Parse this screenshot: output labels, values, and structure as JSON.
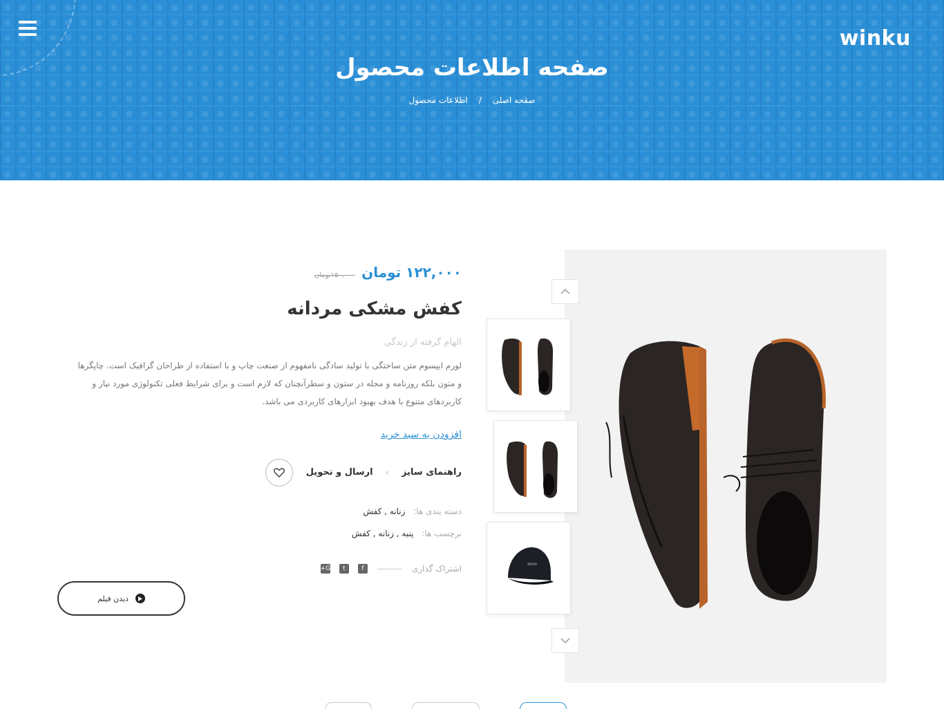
{
  "header": {
    "logo": "winku",
    "title": "صفحه اطلاعات محصول",
    "breadcrumb": {
      "home": "صفحه اصلی",
      "separator": "/",
      "current": "اطلاعات محصول"
    }
  },
  "product": {
    "price": "۱۲۲,۰۰۰ تومان",
    "old_price": "۱۵۰,۰۰۰تومان",
    "title": "کفش مشکی مردانه",
    "subtitle": "الهام گرفته از زندگی",
    "description": "لورم ایپسوم متن ساختگی با تولید سادگی نامفهوم از صنعت چاپ و با استفاده از طراحان گرافیک است. چاپگرها و متون بلکه روزنامه و مجله در ستون و سطرآنچنان که لازم است و برای شرایط فعلی تکنولوژی مورد نیاز و کاربردهای متنوع با هدف بهبود ابزارهای کاربردی می باشد.",
    "add_to_cart": "افزودن به سبد خرید",
    "size_guide": "راهنمای سایز",
    "link_separator": "×",
    "shipping": "ارسال و تحویل",
    "categories_label": "دسته بندی ها:",
    "categories_value": "زنانه , کفش",
    "tags_label": "برچسب ها:",
    "tags_value": "پنبه , زنانه , کفش",
    "share_label": "اشتراک گذاری",
    "video_button": "دیدن فیلم"
  },
  "social": {
    "facebook": "f",
    "twitter": "t",
    "google": "G+"
  },
  "colors": {
    "accent": "#2a8fd6",
    "hero": "#2a8fd6",
    "text": "#333333",
    "muted": "#aaaaaa"
  },
  "icons": {
    "menu": "hamburger-menu-icon",
    "wishlist": "heart-icon",
    "play": "play-icon",
    "up": "chevron-up-icon",
    "down": "chevron-down-icon"
  }
}
